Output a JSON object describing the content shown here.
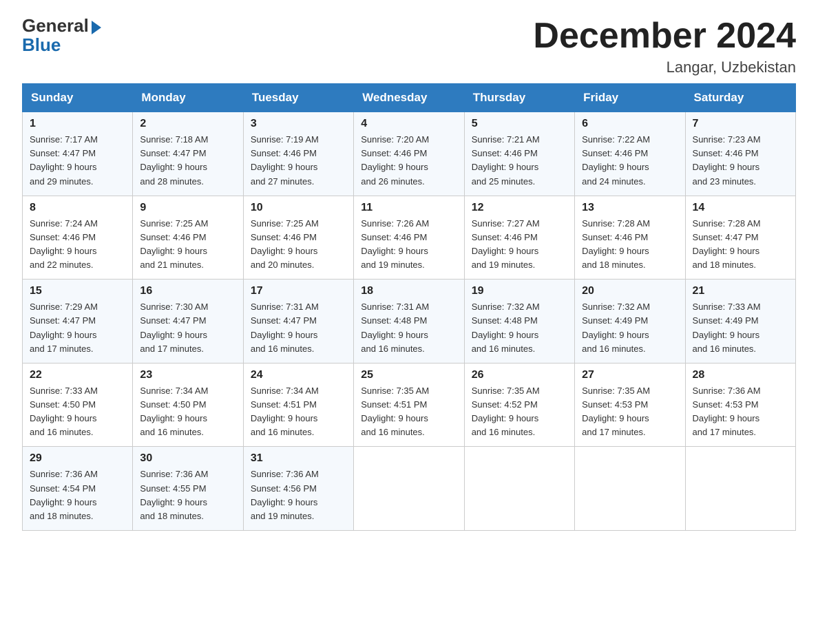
{
  "logo": {
    "general": "General",
    "blue": "Blue"
  },
  "title": "December 2024",
  "location": "Langar, Uzbekistan",
  "weekdays": [
    "Sunday",
    "Monday",
    "Tuesday",
    "Wednesday",
    "Thursday",
    "Friday",
    "Saturday"
  ],
  "weeks": [
    [
      {
        "day": "1",
        "sunrise": "7:17 AM",
        "sunset": "4:47 PM",
        "daylight": "9 hours and 29 minutes."
      },
      {
        "day": "2",
        "sunrise": "7:18 AM",
        "sunset": "4:47 PM",
        "daylight": "9 hours and 28 minutes."
      },
      {
        "day": "3",
        "sunrise": "7:19 AM",
        "sunset": "4:46 PM",
        "daylight": "9 hours and 27 minutes."
      },
      {
        "day": "4",
        "sunrise": "7:20 AM",
        "sunset": "4:46 PM",
        "daylight": "9 hours and 26 minutes."
      },
      {
        "day": "5",
        "sunrise": "7:21 AM",
        "sunset": "4:46 PM",
        "daylight": "9 hours and 25 minutes."
      },
      {
        "day": "6",
        "sunrise": "7:22 AM",
        "sunset": "4:46 PM",
        "daylight": "9 hours and 24 minutes."
      },
      {
        "day": "7",
        "sunrise": "7:23 AM",
        "sunset": "4:46 PM",
        "daylight": "9 hours and 23 minutes."
      }
    ],
    [
      {
        "day": "8",
        "sunrise": "7:24 AM",
        "sunset": "4:46 PM",
        "daylight": "9 hours and 22 minutes."
      },
      {
        "day": "9",
        "sunrise": "7:25 AM",
        "sunset": "4:46 PM",
        "daylight": "9 hours and 21 minutes."
      },
      {
        "day": "10",
        "sunrise": "7:25 AM",
        "sunset": "4:46 PM",
        "daylight": "9 hours and 20 minutes."
      },
      {
        "day": "11",
        "sunrise": "7:26 AM",
        "sunset": "4:46 PM",
        "daylight": "9 hours and 19 minutes."
      },
      {
        "day": "12",
        "sunrise": "7:27 AM",
        "sunset": "4:46 PM",
        "daylight": "9 hours and 19 minutes."
      },
      {
        "day": "13",
        "sunrise": "7:28 AM",
        "sunset": "4:46 PM",
        "daylight": "9 hours and 18 minutes."
      },
      {
        "day": "14",
        "sunrise": "7:28 AM",
        "sunset": "4:47 PM",
        "daylight": "9 hours and 18 minutes."
      }
    ],
    [
      {
        "day": "15",
        "sunrise": "7:29 AM",
        "sunset": "4:47 PM",
        "daylight": "9 hours and 17 minutes."
      },
      {
        "day": "16",
        "sunrise": "7:30 AM",
        "sunset": "4:47 PM",
        "daylight": "9 hours and 17 minutes."
      },
      {
        "day": "17",
        "sunrise": "7:31 AM",
        "sunset": "4:47 PM",
        "daylight": "9 hours and 16 minutes."
      },
      {
        "day": "18",
        "sunrise": "7:31 AM",
        "sunset": "4:48 PM",
        "daylight": "9 hours and 16 minutes."
      },
      {
        "day": "19",
        "sunrise": "7:32 AM",
        "sunset": "4:48 PM",
        "daylight": "9 hours and 16 minutes."
      },
      {
        "day": "20",
        "sunrise": "7:32 AM",
        "sunset": "4:49 PM",
        "daylight": "9 hours and 16 minutes."
      },
      {
        "day": "21",
        "sunrise": "7:33 AM",
        "sunset": "4:49 PM",
        "daylight": "9 hours and 16 minutes."
      }
    ],
    [
      {
        "day": "22",
        "sunrise": "7:33 AM",
        "sunset": "4:50 PM",
        "daylight": "9 hours and 16 minutes."
      },
      {
        "day": "23",
        "sunrise": "7:34 AM",
        "sunset": "4:50 PM",
        "daylight": "9 hours and 16 minutes."
      },
      {
        "day": "24",
        "sunrise": "7:34 AM",
        "sunset": "4:51 PM",
        "daylight": "9 hours and 16 minutes."
      },
      {
        "day": "25",
        "sunrise": "7:35 AM",
        "sunset": "4:51 PM",
        "daylight": "9 hours and 16 minutes."
      },
      {
        "day": "26",
        "sunrise": "7:35 AM",
        "sunset": "4:52 PM",
        "daylight": "9 hours and 16 minutes."
      },
      {
        "day": "27",
        "sunrise": "7:35 AM",
        "sunset": "4:53 PM",
        "daylight": "9 hours and 17 minutes."
      },
      {
        "day": "28",
        "sunrise": "7:36 AM",
        "sunset": "4:53 PM",
        "daylight": "9 hours and 17 minutes."
      }
    ],
    [
      {
        "day": "29",
        "sunrise": "7:36 AM",
        "sunset": "4:54 PM",
        "daylight": "9 hours and 18 minutes."
      },
      {
        "day": "30",
        "sunrise": "7:36 AM",
        "sunset": "4:55 PM",
        "daylight": "9 hours and 18 minutes."
      },
      {
        "day": "31",
        "sunrise": "7:36 AM",
        "sunset": "4:56 PM",
        "daylight": "9 hours and 19 minutes."
      },
      null,
      null,
      null,
      null
    ]
  ],
  "labels": {
    "sunrise": "Sunrise:",
    "sunset": "Sunset:",
    "daylight": "Daylight:"
  }
}
